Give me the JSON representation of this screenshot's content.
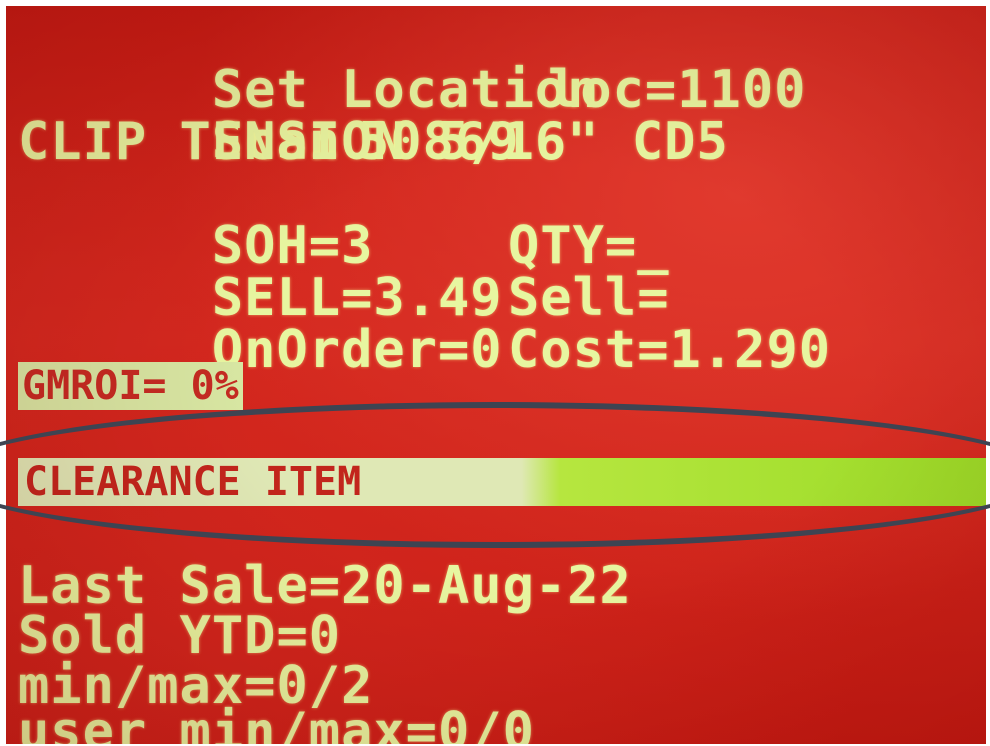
{
  "terminal": {
    "location_label": "Set Location",
    "location_value": "loc=1100",
    "scan_label": "Scan",
    "scan_value": "50869",
    "item_description": "CLIP TENSION 5/16\" CD5",
    "soh": "SOH=3",
    "qty": "QTY=_",
    "sell": "SELL=3.49",
    "sell_input": "Sell=",
    "on_order": "OnOrder=0",
    "cost": "Cost=1.290",
    "gmroi": "GMROI= 0%",
    "clearance": "CLEARANCE ITEM",
    "last_sale": "Last Sale=20-Aug-22",
    "sold_ytd": "Sold YTD=0",
    "min_max": "min/max=0/2",
    "user_min_max": "user min/max=0/0"
  },
  "colors": {
    "screen_background": "#d0241b",
    "text": "#e7f6a0",
    "clearance_bar": "#9bdc27",
    "annotation_ellipse": "#3e4452"
  }
}
